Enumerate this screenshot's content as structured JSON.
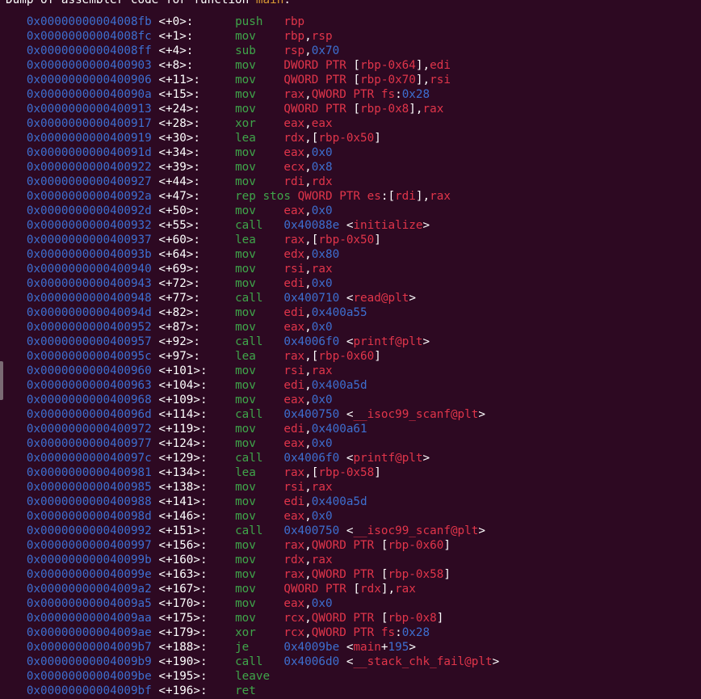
{
  "header": {
    "prefix": "Dump of assembler code for function ",
    "function_name": "main",
    "suffix": ":"
  },
  "colors": {
    "background": "#2d0922",
    "address": "#3d6fd0",
    "mnemonic": "#3fa54a",
    "register": "#e0354a",
    "number": "#3d6fd0",
    "function_name": "#d99a33",
    "text": "#ffffff"
  },
  "lines": [
    {
      "addr": "0x00000000004008fb",
      "off": "<+0>:",
      "mn": "push",
      "ops": [
        [
          "reg",
          "rbp"
        ]
      ]
    },
    {
      "addr": "0x00000000004008fc",
      "off": "<+1>:",
      "mn": "mov",
      "ops": [
        [
          "reg",
          "rbp"
        ],
        [
          "plain",
          ","
        ],
        [
          "reg",
          "rsp"
        ]
      ]
    },
    {
      "addr": "0x00000000004008ff",
      "off": "<+4>:",
      "mn": "sub",
      "ops": [
        [
          "reg",
          "rsp"
        ],
        [
          "plain",
          ","
        ],
        [
          "num",
          "0x70"
        ]
      ]
    },
    {
      "addr": "0x0000000000400903",
      "off": "<+8>:",
      "mn": "mov",
      "ops": [
        [
          "reg",
          "DWORD PTR "
        ],
        [
          "plain",
          "["
        ],
        [
          "reg",
          "rbp-0x64"
        ],
        [
          "plain",
          "],"
        ],
        [
          "reg",
          "edi"
        ]
      ]
    },
    {
      "addr": "0x0000000000400906",
      "off": "<+11>:",
      "mn": "mov",
      "ops": [
        [
          "reg",
          "QWORD PTR "
        ],
        [
          "plain",
          "["
        ],
        [
          "reg",
          "rbp-0x70"
        ],
        [
          "plain",
          "],"
        ],
        [
          "reg",
          "rsi"
        ]
      ]
    },
    {
      "addr": "0x000000000040090a",
      "off": "<+15>:",
      "mn": "mov",
      "ops": [
        [
          "reg",
          "rax"
        ],
        [
          "plain",
          ","
        ],
        [
          "reg",
          "QWORD PTR "
        ],
        [
          "reg",
          "fs"
        ],
        [
          "plain",
          ":"
        ],
        [
          "num",
          "0x28"
        ]
      ]
    },
    {
      "addr": "0x0000000000400913",
      "off": "<+24>:",
      "mn": "mov",
      "ops": [
        [
          "reg",
          "QWORD PTR "
        ],
        [
          "plain",
          "["
        ],
        [
          "reg",
          "rbp-0x8"
        ],
        [
          "plain",
          "],"
        ],
        [
          "reg",
          "rax"
        ]
      ]
    },
    {
      "addr": "0x0000000000400917",
      "off": "<+28>:",
      "mn": "xor",
      "ops": [
        [
          "reg",
          "eax"
        ],
        [
          "plain",
          ","
        ],
        [
          "reg",
          "eax"
        ]
      ]
    },
    {
      "addr": "0x0000000000400919",
      "off": "<+30>:",
      "mn": "lea",
      "ops": [
        [
          "reg",
          "rdx"
        ],
        [
          "plain",
          ",["
        ],
        [
          "reg",
          "rbp-0x50"
        ],
        [
          "plain",
          "]"
        ]
      ]
    },
    {
      "addr": "0x000000000040091d",
      "off": "<+34>:",
      "mn": "mov",
      "ops": [
        [
          "reg",
          "eax"
        ],
        [
          "plain",
          ","
        ],
        [
          "num",
          "0x0"
        ]
      ]
    },
    {
      "addr": "0x0000000000400922",
      "off": "<+39>:",
      "mn": "mov",
      "ops": [
        [
          "reg",
          "ecx"
        ],
        [
          "plain",
          ","
        ],
        [
          "num",
          "0x8"
        ]
      ]
    },
    {
      "addr": "0x0000000000400927",
      "off": "<+44>:",
      "mn": "mov",
      "ops": [
        [
          "reg",
          "rdi"
        ],
        [
          "plain",
          ","
        ],
        [
          "reg",
          "rdx"
        ]
      ]
    },
    {
      "addr": "0x000000000040092a",
      "off": "<+47>:",
      "mn": "rep stos",
      "ops": [
        [
          "plain",
          " "
        ],
        [
          "reg",
          "QWORD PTR "
        ],
        [
          "reg",
          "es"
        ],
        [
          "plain",
          ":["
        ],
        [
          "reg",
          "rdi"
        ],
        [
          "plain",
          "],"
        ],
        [
          "reg",
          "rax"
        ]
      ]
    },
    {
      "addr": "0x000000000040092d",
      "off": "<+50>:",
      "mn": "mov",
      "ops": [
        [
          "reg",
          "eax"
        ],
        [
          "plain",
          ","
        ],
        [
          "num",
          "0x0"
        ]
      ]
    },
    {
      "addr": "0x0000000000400932",
      "off": "<+55>:",
      "mn": "call",
      "ops": [
        [
          "num",
          "0x40088e"
        ],
        [
          "plain",
          " <"
        ],
        [
          "sym",
          "initialize"
        ],
        [
          "plain",
          ">"
        ]
      ]
    },
    {
      "addr": "0x0000000000400937",
      "off": "<+60>:",
      "mn": "lea",
      "ops": [
        [
          "reg",
          "rax"
        ],
        [
          "plain",
          ",["
        ],
        [
          "reg",
          "rbp-0x50"
        ],
        [
          "plain",
          "]"
        ]
      ]
    },
    {
      "addr": "0x000000000040093b",
      "off": "<+64>:",
      "mn": "mov",
      "ops": [
        [
          "reg",
          "edx"
        ],
        [
          "plain",
          ","
        ],
        [
          "num",
          "0x80"
        ]
      ]
    },
    {
      "addr": "0x0000000000400940",
      "off": "<+69>:",
      "mn": "mov",
      "ops": [
        [
          "reg",
          "rsi"
        ],
        [
          "plain",
          ","
        ],
        [
          "reg",
          "rax"
        ]
      ]
    },
    {
      "addr": "0x0000000000400943",
      "off": "<+72>:",
      "mn": "mov",
      "ops": [
        [
          "reg",
          "edi"
        ],
        [
          "plain",
          ","
        ],
        [
          "num",
          "0x0"
        ]
      ]
    },
    {
      "addr": "0x0000000000400948",
      "off": "<+77>:",
      "mn": "call",
      "ops": [
        [
          "num",
          "0x400710"
        ],
        [
          "plain",
          " <"
        ],
        [
          "sym",
          "read@plt"
        ],
        [
          "plain",
          ">"
        ]
      ]
    },
    {
      "addr": "0x000000000040094d",
      "off": "<+82>:",
      "mn": "mov",
      "ops": [
        [
          "reg",
          "edi"
        ],
        [
          "plain",
          ","
        ],
        [
          "num",
          "0x400a55"
        ]
      ]
    },
    {
      "addr": "0x0000000000400952",
      "off": "<+87>:",
      "mn": "mov",
      "ops": [
        [
          "reg",
          "eax"
        ],
        [
          "plain",
          ","
        ],
        [
          "num",
          "0x0"
        ]
      ]
    },
    {
      "addr": "0x0000000000400957",
      "off": "<+92>:",
      "mn": "call",
      "ops": [
        [
          "num",
          "0x4006f0"
        ],
        [
          "plain",
          " <"
        ],
        [
          "sym",
          "printf@plt"
        ],
        [
          "plain",
          ">"
        ]
      ]
    },
    {
      "addr": "0x000000000040095c",
      "off": "<+97>:",
      "mn": "lea",
      "ops": [
        [
          "reg",
          "rax"
        ],
        [
          "plain",
          ",["
        ],
        [
          "reg",
          "rbp-0x60"
        ],
        [
          "plain",
          "]"
        ]
      ]
    },
    {
      "addr": "0x0000000000400960",
      "off": "<+101>:",
      "mn": "mov",
      "ops": [
        [
          "reg",
          "rsi"
        ],
        [
          "plain",
          ","
        ],
        [
          "reg",
          "rax"
        ]
      ]
    },
    {
      "addr": "0x0000000000400963",
      "off": "<+104>:",
      "mn": "mov",
      "ops": [
        [
          "reg",
          "edi"
        ],
        [
          "plain",
          ","
        ],
        [
          "num",
          "0x400a5d"
        ]
      ]
    },
    {
      "addr": "0x0000000000400968",
      "off": "<+109>:",
      "mn": "mov",
      "ops": [
        [
          "reg",
          "eax"
        ],
        [
          "plain",
          ","
        ],
        [
          "num",
          "0x0"
        ]
      ]
    },
    {
      "addr": "0x000000000040096d",
      "off": "<+114>:",
      "mn": "call",
      "ops": [
        [
          "num",
          "0x400750"
        ],
        [
          "plain",
          " <"
        ],
        [
          "sym",
          "__isoc99_scanf@plt"
        ],
        [
          "plain",
          ">"
        ]
      ]
    },
    {
      "addr": "0x0000000000400972",
      "off": "<+119>:",
      "mn": "mov",
      "ops": [
        [
          "reg",
          "edi"
        ],
        [
          "plain",
          ","
        ],
        [
          "num",
          "0x400a61"
        ]
      ]
    },
    {
      "addr": "0x0000000000400977",
      "off": "<+124>:",
      "mn": "mov",
      "ops": [
        [
          "reg",
          "eax"
        ],
        [
          "plain",
          ","
        ],
        [
          "num",
          "0x0"
        ]
      ]
    },
    {
      "addr": "0x000000000040097c",
      "off": "<+129>:",
      "mn": "call",
      "ops": [
        [
          "num",
          "0x4006f0"
        ],
        [
          "plain",
          " <"
        ],
        [
          "sym",
          "printf@plt"
        ],
        [
          "plain",
          ">"
        ]
      ]
    },
    {
      "addr": "0x0000000000400981",
      "off": "<+134>:",
      "mn": "lea",
      "ops": [
        [
          "reg",
          "rax"
        ],
        [
          "plain",
          ",["
        ],
        [
          "reg",
          "rbp-0x58"
        ],
        [
          "plain",
          "]"
        ]
      ]
    },
    {
      "addr": "0x0000000000400985",
      "off": "<+138>:",
      "mn": "mov",
      "ops": [
        [
          "reg",
          "rsi"
        ],
        [
          "plain",
          ","
        ],
        [
          "reg",
          "rax"
        ]
      ]
    },
    {
      "addr": "0x0000000000400988",
      "off": "<+141>:",
      "mn": "mov",
      "ops": [
        [
          "reg",
          "edi"
        ],
        [
          "plain",
          ","
        ],
        [
          "num",
          "0x400a5d"
        ]
      ]
    },
    {
      "addr": "0x000000000040098d",
      "off": "<+146>:",
      "mn": "mov",
      "ops": [
        [
          "reg",
          "eax"
        ],
        [
          "plain",
          ","
        ],
        [
          "num",
          "0x0"
        ]
      ]
    },
    {
      "addr": "0x0000000000400992",
      "off": "<+151>:",
      "mn": "call",
      "ops": [
        [
          "num",
          "0x400750"
        ],
        [
          "plain",
          " <"
        ],
        [
          "sym",
          "__isoc99_scanf@plt"
        ],
        [
          "plain",
          ">"
        ]
      ]
    },
    {
      "addr": "0x0000000000400997",
      "off": "<+156>:",
      "mn": "mov",
      "ops": [
        [
          "reg",
          "rax"
        ],
        [
          "plain",
          ","
        ],
        [
          "reg",
          "QWORD PTR "
        ],
        [
          "plain",
          "["
        ],
        [
          "reg",
          "rbp-0x60"
        ],
        [
          "plain",
          "]"
        ]
      ]
    },
    {
      "addr": "0x000000000040099b",
      "off": "<+160>:",
      "mn": "mov",
      "ops": [
        [
          "reg",
          "rdx"
        ],
        [
          "plain",
          ","
        ],
        [
          "reg",
          "rax"
        ]
      ]
    },
    {
      "addr": "0x000000000040099e",
      "off": "<+163>:",
      "mn": "mov",
      "ops": [
        [
          "reg",
          "rax"
        ],
        [
          "plain",
          ","
        ],
        [
          "reg",
          "QWORD PTR "
        ],
        [
          "plain",
          "["
        ],
        [
          "reg",
          "rbp-0x58"
        ],
        [
          "plain",
          "]"
        ]
      ]
    },
    {
      "addr": "0x00000000004009a2",
      "off": "<+167>:",
      "mn": "mov",
      "ops": [
        [
          "reg",
          "QWORD PTR "
        ],
        [
          "plain",
          "["
        ],
        [
          "reg",
          "rdx"
        ],
        [
          "plain",
          "],"
        ],
        [
          "reg",
          "rax"
        ]
      ]
    },
    {
      "addr": "0x00000000004009a5",
      "off": "<+170>:",
      "mn": "mov",
      "ops": [
        [
          "reg",
          "eax"
        ],
        [
          "plain",
          ","
        ],
        [
          "num",
          "0x0"
        ]
      ]
    },
    {
      "addr": "0x00000000004009aa",
      "off": "<+175>:",
      "mn": "mov",
      "ops": [
        [
          "reg",
          "rcx"
        ],
        [
          "plain",
          ","
        ],
        [
          "reg",
          "QWORD PTR "
        ],
        [
          "plain",
          "["
        ],
        [
          "reg",
          "rbp-0x8"
        ],
        [
          "plain",
          "]"
        ]
      ]
    },
    {
      "addr": "0x00000000004009ae",
      "off": "<+179>:",
      "mn": "xor",
      "ops": [
        [
          "reg",
          "rcx"
        ],
        [
          "plain",
          ","
        ],
        [
          "reg",
          "QWORD PTR "
        ],
        [
          "reg",
          "fs"
        ],
        [
          "plain",
          ":"
        ],
        [
          "num",
          "0x28"
        ]
      ]
    },
    {
      "addr": "0x00000000004009b7",
      "off": "<+188>:",
      "mn": "je",
      "ops": [
        [
          "num",
          "0x4009be"
        ],
        [
          "plain",
          " <"
        ],
        [
          "sym",
          "main"
        ],
        [
          "plain",
          "+"
        ],
        [
          "num",
          "195"
        ],
        [
          "plain",
          ">"
        ]
      ]
    },
    {
      "addr": "0x00000000004009b9",
      "off": "<+190>:",
      "mn": "call",
      "ops": [
        [
          "num",
          "0x4006d0"
        ],
        [
          "plain",
          " <"
        ],
        [
          "sym",
          "__stack_chk_fail@plt"
        ],
        [
          "plain",
          ">"
        ]
      ]
    },
    {
      "addr": "0x00000000004009be",
      "off": "<+195>:",
      "mn": "leave",
      "ops": []
    },
    {
      "addr": "0x00000000004009bf",
      "off": "<+196>:",
      "mn": "ret",
      "ops": []
    }
  ]
}
